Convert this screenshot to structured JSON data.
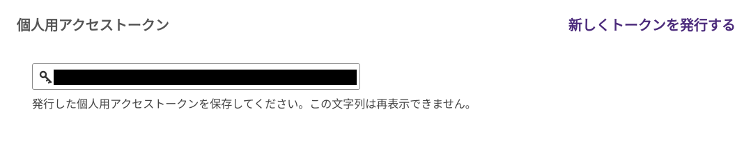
{
  "section": {
    "title": "個人用アクセストークン",
    "generate_link": "新しくトークンを発行する"
  },
  "token_field": {
    "icon": "key-icon",
    "value": ""
  },
  "help_text": "発行した個人用アクセストークンを保存してください。この文字列は再表示できません。",
  "colors": {
    "title": "#555555",
    "link": "#4b2a7b",
    "field_border": "#8a8a8a",
    "redaction": "#000000"
  }
}
